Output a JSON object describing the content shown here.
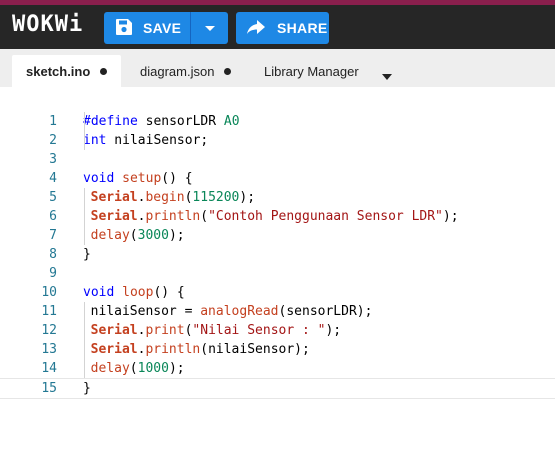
{
  "app": {
    "logo": "WOKWi"
  },
  "toolbar": {
    "save_label": "SAVE",
    "share_label": "SHARE"
  },
  "tabs": [
    {
      "label": "sketch.ino"
    },
    {
      "label": "diagram.json"
    },
    {
      "label": "Library Manager"
    }
  ],
  "editor": {
    "line_numbers": [
      "1",
      "2",
      "3",
      "4",
      "5",
      "6",
      "7",
      "8",
      "9",
      "10",
      "11",
      "12",
      "13",
      "14",
      "15"
    ],
    "lines": [
      "#define sensorLDR A0",
      "int nilaiSensor;",
      "",
      "void setup() {",
      "  Serial.begin(115200);",
      "  Serial.println(\"Contoh Penggunaan Sensor LDR\");",
      "  delay(3000);",
      "}",
      "",
      "void loop() {",
      "  nilaiSensor = analogRead(sensorLDR);",
      "  Serial.print(\"Nilai Sensor : \");",
      "  Serial.println(nilaiSensor);",
      "  delay(1000);",
      "}"
    ]
  },
  "colors": {
    "header_bg": "#262626",
    "accent": "#1e88e5",
    "topline": "#8a1f4d"
  }
}
